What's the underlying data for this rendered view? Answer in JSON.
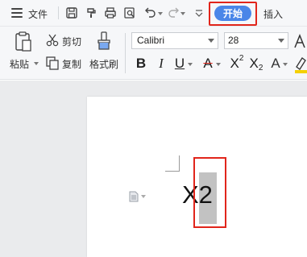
{
  "menubar": {
    "file_label": "文件",
    "tab_start": "开始",
    "tab_insert": "插入",
    "quick_access_icons": [
      "save-icon",
      "format-painter-icon",
      "print-icon",
      "print-preview-icon",
      "undo-icon",
      "redo-icon",
      "customize-icon"
    ]
  },
  "ribbon": {
    "paste_label": "粘贴",
    "cut_label": "剪切",
    "copy_label": "复制",
    "format_painter_label": "格式刷",
    "font_name": "Calibri",
    "font_size": "28",
    "bold": "B",
    "italic": "I",
    "underline": "U",
    "strike": "A",
    "superscript_base": "X",
    "superscript_exp": "2",
    "subscript_base": "X",
    "subscript_exp": "2",
    "text_effect": "A"
  },
  "document": {
    "text": "X2"
  },
  "colors": {
    "accent": "#4a86e8",
    "highlight_border": "#e1251b",
    "selection": "#c2c2c2"
  }
}
